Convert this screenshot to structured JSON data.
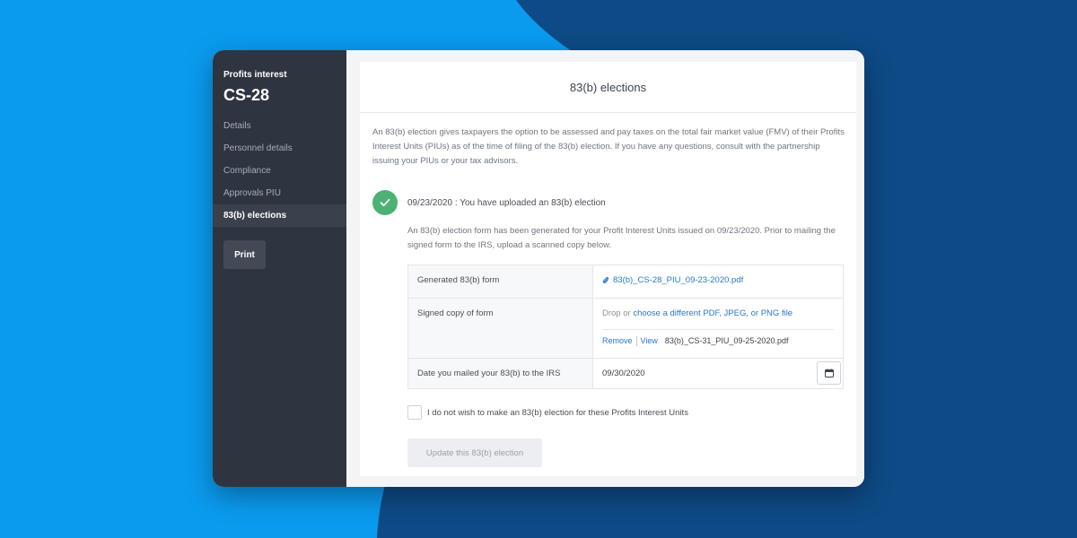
{
  "colors": {
    "background": "#0a9bef",
    "background_shape": "#0e4a86",
    "sidebar": "#2f3540",
    "accent_link": "#2a78c8",
    "success": "#4cb173"
  },
  "sidebar": {
    "kicker": "Profits interest",
    "case_id": "CS-28",
    "items": [
      {
        "label": "Details"
      },
      {
        "label": "Personnel details"
      },
      {
        "label": "Compliance"
      },
      {
        "label": "Approvals PIU"
      },
      {
        "label": "83(b) elections",
        "active": true
      }
    ],
    "print_label": "Print"
  },
  "main": {
    "title": "83(b) elections",
    "intro": "An 83(b) election gives taxpayers the option to be assessed and pay taxes on the total fair market value (FMV) of their Profits Interest Units (PIUs) as of the time of filing of the 83(b) election. If you have any questions, consult with the partnership issuing your PIUs or your tax advisors.",
    "status": {
      "icon": "check-icon",
      "text": "09/23/2020 : You have uploaded an 83(b) election"
    },
    "generated_text": "An 83(b) election form has been generated for your Profit Interest Units issued on 09/23/2020. Prior to mailing the signed form to the IRS, upload a scanned copy below.",
    "table": {
      "generated_label": "Generated 83(b) form",
      "generated_file": "83(b)_CS-28_PIU_09-23-2020.pdf",
      "signed_label": "Signed copy of form",
      "drop_prefix": "Drop or ",
      "drop_link": "choose a different PDF, JPEG, or PNG file",
      "remove_label": "Remove",
      "view_label": "View",
      "uploaded_file": "83(b)_CS-31_PIU_09-25-2020.pdf",
      "mailed_label": "Date you mailed your 83(b) to the IRS",
      "mailed_date": "09/30/2020"
    },
    "optout_label": "I do not wish to make an 83(b) election for these Profits Interest Units",
    "optout_checked": false,
    "update_button": "Update this 83(b) election"
  }
}
